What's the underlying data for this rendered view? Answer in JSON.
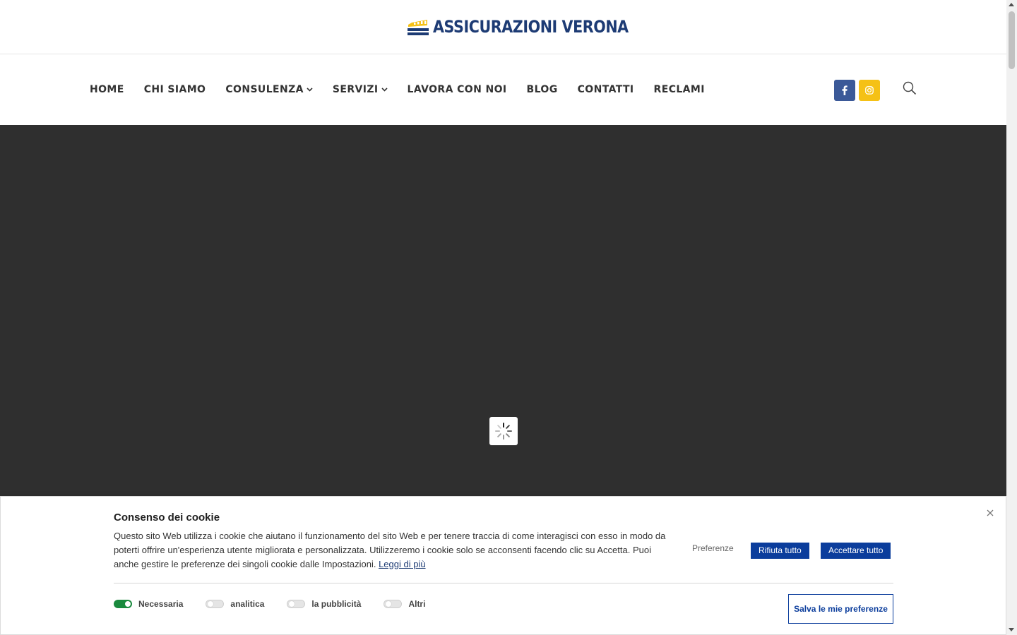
{
  "brand": {
    "name": "ASSICURAZIONI VERONA",
    "color": "#1d3b74",
    "accent": "#f5c116"
  },
  "nav": {
    "items": [
      {
        "label": "HOME",
        "has_dropdown": false
      },
      {
        "label": "CHI SIAMO",
        "has_dropdown": false
      },
      {
        "label": "CONSULENZA",
        "has_dropdown": true
      },
      {
        "label": "SERVIZI",
        "has_dropdown": true
      },
      {
        "label": "LAVORA CON NOI",
        "has_dropdown": false
      },
      {
        "label": "BLOG",
        "has_dropdown": false
      },
      {
        "label": "CONTATTI",
        "has_dropdown": false
      },
      {
        "label": "RECLAMI",
        "has_dropdown": false
      }
    ],
    "social": [
      {
        "icon": "facebook-icon",
        "color": "#3b5998"
      },
      {
        "icon": "instagram-icon",
        "color": "#f5c116"
      }
    ],
    "search_icon": "search-icon"
  },
  "hero": {
    "background": "#2f2f2f",
    "loader_icon": "spinner-icon"
  },
  "cookie": {
    "title": "Consenso dei cookie",
    "text": "Questo sito Web utilizza i cookie che aiutano il funzionamento del sito Web e per tenere traccia di come interagisci con esso in modo da poterti offrire un'esperienza utente migliorata e personalizzata. Utilizzeremo i cookie solo se acconsenti facendo clic su Accetta. Puoi anche gestire le preferenze dei singoli cookie dalle Impostazioni. ",
    "read_more": "Leggi di più",
    "preferences_label": "Preferenze",
    "reject_label": "Rifiuta tutto",
    "accept_label": "Accettare tutto",
    "save_label": "Salva le mie preferenze",
    "button_color": "#0b3d9c",
    "toggles": [
      {
        "label": "Necessaria",
        "on": true
      },
      {
        "label": "analitica",
        "on": false
      },
      {
        "label": "la pubblicità",
        "on": false
      },
      {
        "label": "Altri",
        "on": false
      }
    ]
  }
}
